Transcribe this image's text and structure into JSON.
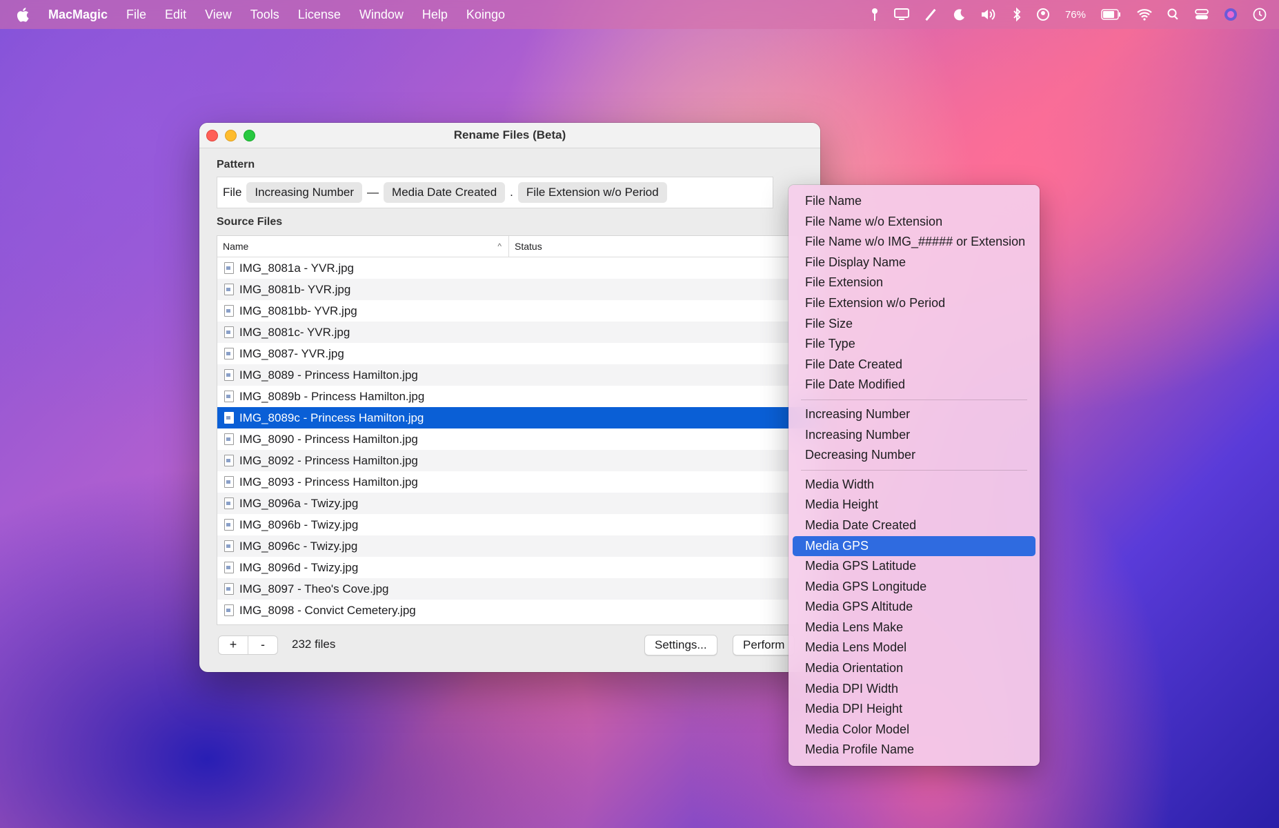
{
  "menubar": {
    "app_name": "MacMagic",
    "items": [
      "File",
      "Edit",
      "View",
      "Tools",
      "License",
      "Window",
      "Help",
      "Koingo"
    ],
    "battery": "76%"
  },
  "window": {
    "title": "Rename Files (Beta)",
    "pattern_label": "Pattern",
    "pattern": {
      "prefix": "File",
      "token1": "Increasing Number",
      "separator1": "—",
      "token2": "Media Date Created",
      "separator2": ".",
      "token3": "File Extension w/o Period"
    },
    "source_label": "Source Files",
    "columns": {
      "name": "Name",
      "status": "Status"
    },
    "files": [
      "IMG_8081a - YVR.jpg",
      "IMG_8081b- YVR.jpg",
      "IMG_8081bb- YVR.jpg",
      "IMG_8081c- YVR.jpg",
      "IMG_8087- YVR.jpg",
      "IMG_8089 - Princess Hamilton.jpg",
      "IMG_8089b - Princess Hamilton.jpg",
      "IMG_8089c - Princess Hamilton.jpg",
      "IMG_8090 - Princess Hamilton.jpg",
      "IMG_8092 - Princess Hamilton.jpg",
      "IMG_8093 - Princess Hamilton.jpg",
      "IMG_8096a - Twizy.jpg",
      "IMG_8096b - Twizy.jpg",
      "IMG_8096c - Twizy.jpg",
      "IMG_8096d - Twizy.jpg",
      "IMG_8097 - Theo's Cove.jpg",
      "IMG_8098 - Convict Cemetery.jpg"
    ],
    "selected_file": "IMG_8089c - Princess Hamilton.jpg",
    "add_label": "+",
    "remove_label": "-",
    "file_count": "232 files",
    "settings_label": "Settings...",
    "perform_label": "Perform"
  },
  "dropdown": {
    "groups": [
      [
        "File Name",
        "File Name w/o Extension",
        "File Name w/o IMG_##### or Extension",
        "File Display Name",
        "File Extension",
        "File Extension w/o Period",
        "File Size",
        "File Type",
        "File Date Created",
        "File Date Modified"
      ],
      [
        "Increasing Number",
        "Increasing Number",
        "Decreasing Number"
      ],
      [
        "Media Width",
        "Media Height",
        "Media Date Created",
        "Media GPS",
        "Media GPS Latitude",
        "Media GPS Longitude",
        "Media GPS Altitude",
        "Media Lens Make",
        "Media Lens Model",
        "Media Orientation",
        "Media DPI Width",
        "Media DPI Height",
        "Media Color Model",
        "Media Profile Name"
      ]
    ],
    "highlighted": "Media GPS"
  }
}
